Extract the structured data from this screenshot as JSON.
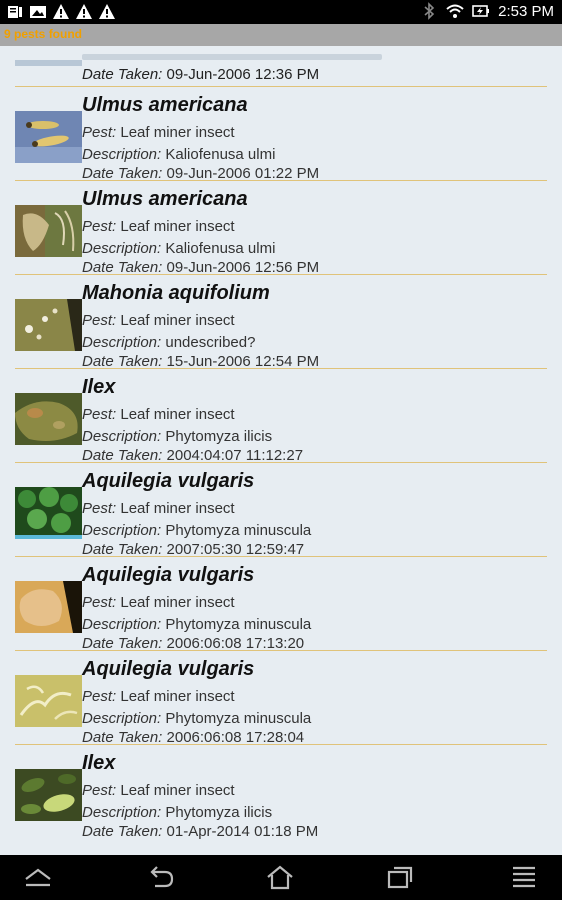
{
  "status_bar": {
    "time": "2:53 PM",
    "left_icons": [
      "notification-icon",
      "image-icon",
      "warning-icon",
      "warning-icon",
      "warning-icon"
    ],
    "right_icons": [
      "bluetooth-icon",
      "wifi-icon",
      "battery-charging-icon"
    ]
  },
  "header": {
    "count_text": "9 pests found",
    "accent": "#f0a000"
  },
  "partial_item": {
    "date_label": "Date Taken:",
    "date_value": "09-Jun-2006 12:36 PM"
  },
  "labels": {
    "pest": "Pest:",
    "description": "Description:",
    "date": "Date Taken:"
  },
  "items": [
    {
      "name": "Ulmus americana",
      "pest": "Leaf miner insect",
      "description": "Kaliofenusa ulmi",
      "date": "09-Jun-2006 01:22 PM",
      "thumb": "larvae-thumbnail"
    },
    {
      "name": "Ulmus americana",
      "pest": "Leaf miner insect",
      "description": "Kaliofenusa ulmi",
      "date": "09-Jun-2006 12:56 PM",
      "thumb": "leaf-thumbnail"
    },
    {
      "name": "Mahonia aquifolium",
      "pest": "Leaf miner insect",
      "description": "undescribed?",
      "date": "15-Jun-2006 12:54 PM",
      "thumb": "leaf-spots-thumbnail"
    },
    {
      "name": "Ilex",
      "pest": "Leaf miner insect",
      "description": "Phytomyza ilicis",
      "date": "2004:04:07 11:12:27",
      "thumb": "holly-leaf-thumbnail"
    },
    {
      "name": "Aquilegia vulgaris",
      "pest": "Leaf miner insect",
      "description": "Phytomyza minuscula",
      "date": "2007:05:30 12:59:47",
      "thumb": "foliage-thumbnail"
    },
    {
      "name": "Aquilegia vulgaris",
      "pest": "Leaf miner insect",
      "description": "Phytomyza minuscula",
      "date": "2006:06:08 17:13:20",
      "thumb": "leaf-closeup-thumbnail"
    },
    {
      "name": "Aquilegia vulgaris",
      "pest": "Leaf miner insect",
      "description": "Phytomyza minuscula",
      "date": "2006:06:08 17:28:04",
      "thumb": "mined-leaf-thumbnail"
    },
    {
      "name": "Ilex",
      "pest": "Leaf miner insect",
      "description": "Phytomyza ilicis",
      "date": "01-Apr-2014 01:18 PM",
      "thumb": "holly-foliage-thumbnail"
    }
  ],
  "nav_bar": [
    "chevron-up-icon",
    "back-icon",
    "home-icon",
    "recent-apps-icon",
    "menu-icon"
  ]
}
